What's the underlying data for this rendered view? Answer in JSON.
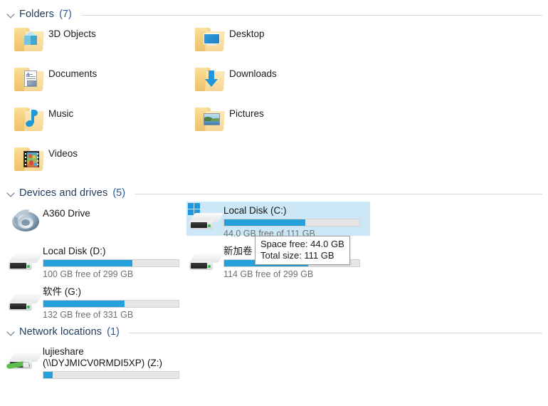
{
  "sections": {
    "folders": {
      "title": "Folders",
      "count": "(7)",
      "chevron_icon": "chevron-down-icon"
    },
    "devices": {
      "title": "Devices and drives",
      "count": "(5)",
      "chevron_icon": "chevron-down-icon"
    },
    "network": {
      "title": "Network locations",
      "count": "(1)",
      "chevron_icon": "chevron-down-icon"
    }
  },
  "folders": [
    {
      "label": "3D Objects",
      "icon": "folder-3d-objects-icon"
    },
    {
      "label": "Desktop",
      "icon": "folder-desktop-icon"
    },
    {
      "label": "Documents",
      "icon": "folder-documents-icon"
    },
    {
      "label": "Downloads",
      "icon": "folder-downloads-icon"
    },
    {
      "label": "Music",
      "icon": "folder-music-icon"
    },
    {
      "label": "Pictures",
      "icon": "folder-pictures-icon"
    },
    {
      "label": "Videos",
      "icon": "folder-videos-icon"
    }
  ],
  "drives": [
    {
      "name": "A360 Drive",
      "icon": "a360-drive-icon",
      "has_bar": false,
      "free_text": "",
      "selected": false
    },
    {
      "name": "Local Disk (C:)",
      "icon": "hard-disk-windows-icon",
      "has_bar": true,
      "fill_percent": 60,
      "free_text": "44.0 GB free of 111 GB",
      "selected": true
    },
    {
      "name": "Local Disk (D:)",
      "icon": "hard-disk-icon",
      "has_bar": true,
      "fill_percent": 66,
      "free_text": "100 GB free of 299 GB",
      "selected": false
    },
    {
      "name": "新加卷",
      "icon": "hard-disk-icon",
      "has_bar": true,
      "fill_percent": 62,
      "free_text": "114 GB free of 299 GB",
      "selected": false
    },
    {
      "name": "软件 (G:)",
      "icon": "hard-disk-icon",
      "has_bar": true,
      "fill_percent": 60,
      "free_text": "132 GB free of 331 GB",
      "selected": false
    }
  ],
  "network_locations": [
    {
      "name": "lujieshare (\\\\DYJMICV0RMDI5XP) (Z:)",
      "icon": "network-drive-icon",
      "has_bar": true,
      "fill_percent": 7,
      "free_text": ""
    }
  ],
  "tooltip": {
    "line1": "Space free: 44.0 GB",
    "line2": "Total size: 111 GB"
  },
  "colors": {
    "accent_bar": "#26a0da",
    "selection": "#cce8f6",
    "section_title": "#1e395b",
    "section_count": "#2b5797",
    "subtext": "#707070"
  }
}
